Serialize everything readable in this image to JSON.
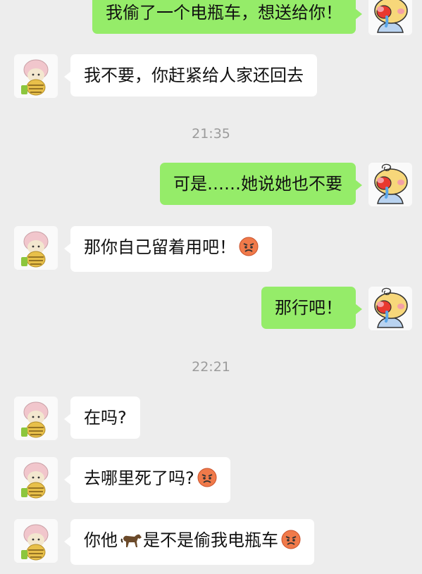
{
  "times": [
    "21:35",
    "22:21"
  ],
  "messages": [
    {
      "dir": "out",
      "text": "我偷了一个电瓶车，想送给你！"
    },
    {
      "dir": "in",
      "text": "我不要，你赶紧给人家还回去"
    },
    {
      "dir": "out",
      "text": "可是……她说她也不要"
    },
    {
      "dir": "in",
      "text": "那你自己留着用吧！",
      "emoji": "angry-face-icon"
    },
    {
      "dir": "out",
      "text": "那行吧！"
    },
    {
      "dir": "in",
      "text": "在吗?"
    },
    {
      "dir": "in",
      "text": "去哪里死了吗?",
      "emoji": "angry-face-icon"
    },
    {
      "dir": "in",
      "text_before": "你他",
      "text_after": "是不是偷我电瓶车",
      "inline_icon": "horse-icon",
      "emoji": "angry-face-icon"
    }
  ],
  "colors": {
    "background": "#ededed",
    "incoming_bubble": "#ffffff",
    "outgoing_bubble": "#95ec69",
    "timestamp": "#9b9b9b"
  },
  "avatars": {
    "incoming": "cat-avatar-icon",
    "outgoing": "bear-avatar-icon"
  }
}
